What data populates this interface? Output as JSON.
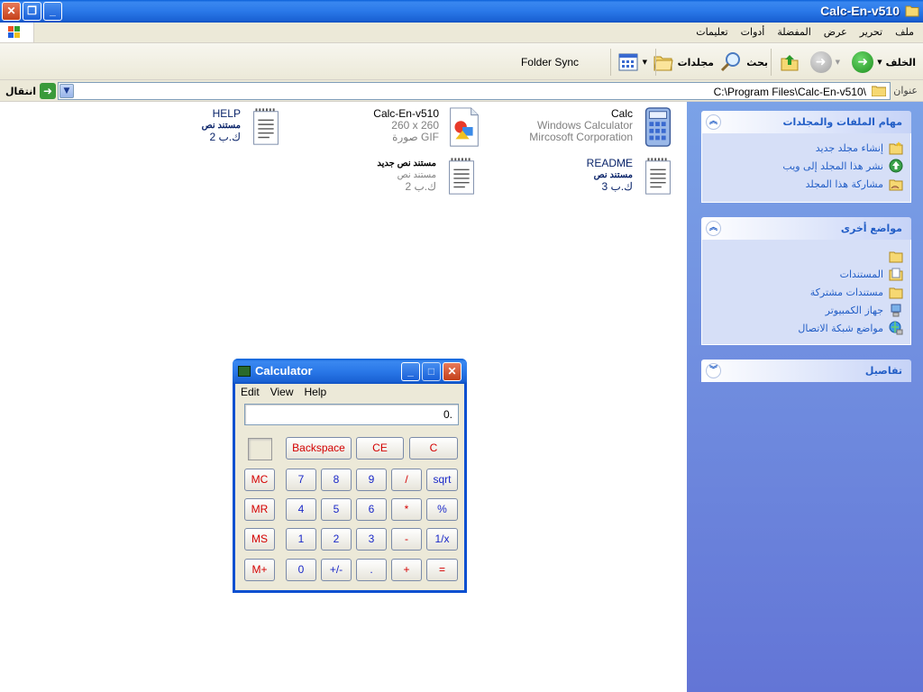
{
  "window": {
    "title": "Calc-En-v510",
    "close": "✕",
    "restore": "❐",
    "minimize": "_"
  },
  "menubar": [
    "ملف",
    "تحرير",
    "عرض",
    "المفضلة",
    "أدوات",
    "تعليمات"
  ],
  "toolbar": {
    "back": "الخلف",
    "search": "بحث",
    "folders": "مجلدات",
    "folder_sync": "Folder Sync"
  },
  "address": {
    "label": "عنوان",
    "path": "C:\\Program Files\\Calc-En-v510\\",
    "go": "انتقال"
  },
  "taskpane": {
    "file_tasks": {
      "title": "مهام الملفات والمجلدات",
      "items": [
        "إنشاء مجلد جديد",
        "نشر هذا المجلد إلى ويب",
        "مشاركة هذا المجلد"
      ]
    },
    "other_places": {
      "title": "مواضع أخرى",
      "items": [
        "",
        "المستندات",
        "مستندات مشتركة",
        "جهاز الكمبيوتر",
        "مواضع شبكة الاتصال"
      ]
    },
    "details": {
      "title": "تفاصيل"
    }
  },
  "files": [
    {
      "name": "Calc",
      "line2": "Windows Calculator",
      "line3": "Mircosoft Corporation",
      "icon": "calculator-icon"
    },
    {
      "name": "Calc-En-v510",
      "line2": "260 x 260",
      "line3": "صورة GIF",
      "icon": "gif-image-icon"
    },
    {
      "name": "HELP",
      "line2": "مستند نص",
      "line3": "2 ك.ب",
      "icon": "text-document-icon"
    },
    {
      "name": "README",
      "line2": "مستند نص",
      "line3": "3 ك.ب",
      "icon": "text-document-icon"
    },
    {
      "name": "مستند نص جديد",
      "line2": "مستند نص",
      "line3": "2 ك.ب",
      "icon": "text-document-icon"
    }
  ],
  "calculator": {
    "title": "Calculator",
    "menu": [
      "Edit",
      "View",
      "Help"
    ],
    "display": "0.",
    "buttons": {
      "backspace": "Backspace",
      "ce": "CE",
      "c": "C",
      "mc": "MC",
      "mr": "MR",
      "ms": "MS",
      "mplus": "M+",
      "d7": "7",
      "d8": "8",
      "d9": "9",
      "div": "/",
      "sqrt": "sqrt",
      "d4": "4",
      "d5": "5",
      "d6": "6",
      "mul": "*",
      "pct": "%",
      "d1": "1",
      "d2": "2",
      "d3": "3",
      "sub": "-",
      "inv": "1/x",
      "d0": "0",
      "sign": "+/-",
      "dot": ".",
      "add": "+",
      "eq": "="
    }
  },
  "colors": {
    "titlebar": "#2a78e8",
    "taskpane": "#7ba2e7",
    "link": "#215dc6"
  }
}
